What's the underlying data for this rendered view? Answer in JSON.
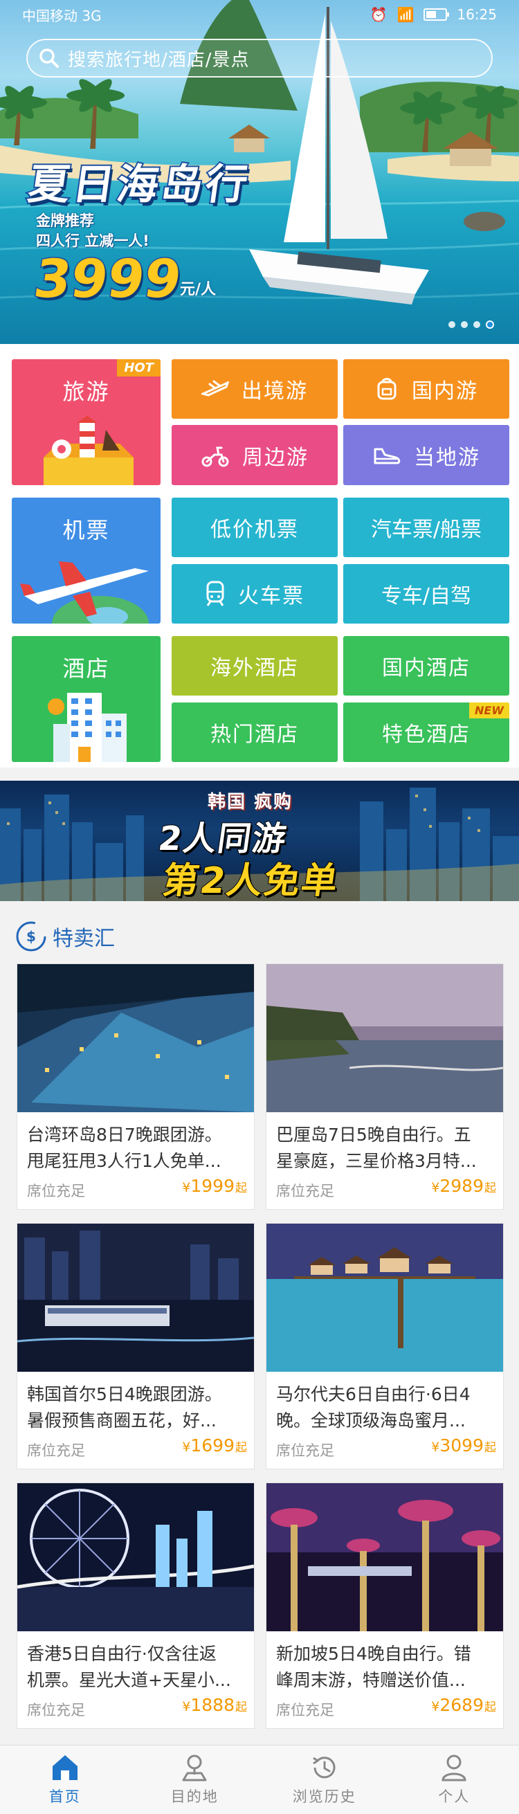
{
  "status_bar": {
    "carrier": "中国移动 3G",
    "network": "3G",
    "time": "16:25"
  },
  "search": {
    "placeholder": "搜索旅行地/酒店/景点"
  },
  "hero_banner": {
    "title": "夏日海岛行",
    "sub1": "金牌推荐",
    "sub2": "四人行 立减一人!",
    "price": "3999",
    "unit": "元/人",
    "dots": 4,
    "active_dot": 3
  },
  "categories": {
    "travel": {
      "label": "旅游",
      "tag": "HOT",
      "color": "#f0506e"
    },
    "outbound": {
      "label": "出境游",
      "color": "#f7911e",
      "icon": "airplane-icon"
    },
    "domestic": {
      "label": "国内游",
      "color": "#f7911e",
      "icon": "backpack-icon"
    },
    "nearby": {
      "label": "周边游",
      "color": "#ea4d86",
      "icon": "scooter-icon"
    },
    "local": {
      "label": "当地游",
      "color": "#7d79e0",
      "icon": "shoe-icon"
    },
    "flights": {
      "label": "机票",
      "color": "#3e8ee6"
    },
    "cheap_flights": {
      "label": "低价机票",
      "color": "#26b5cf"
    },
    "bus_ship": {
      "label": "汽车票/船票",
      "color": "#26b5cf"
    },
    "train": {
      "label": "火车票",
      "color": "#26b5cf",
      "icon": "train-icon"
    },
    "car": {
      "label": "专车/自驾",
      "color": "#26b5cf"
    },
    "hotel": {
      "label": "酒店",
      "color": "#34be5a"
    },
    "overseas_hotel": {
      "label": "海外酒店",
      "color": "#a8c42c"
    },
    "domestic_hotel": {
      "label": "国内酒店",
      "color": "#39c15a"
    },
    "hot_hotel": {
      "label": "热门酒店",
      "color": "#39c15a"
    },
    "special_hotel": {
      "label": "特色酒店",
      "color": "#39c15a",
      "tag": "NEW"
    }
  },
  "banner2": {
    "tag": "韩国 疯购",
    "line1": "2人同游",
    "line2": "第2人免单"
  },
  "special": {
    "title": "特卖汇",
    "items": [
      {
        "line1": "台湾环岛8日7晚跟团游。",
        "line2": "甩尾狂甩3人行1人免单...",
        "avail": "席位充足",
        "yen": "¥",
        "price": "1999",
        "qi": "起"
      },
      {
        "line1": "巴厘岛7日5晚自由行。五",
        "line2": "星豪庭，三星价格3月特...",
        "avail": "席位充足",
        "yen": "¥",
        "price": "2989",
        "qi": "起"
      },
      {
        "line1": "韩国首尔5日4晚跟团游。",
        "line2": "暑假预售商圈五花，好...",
        "avail": "席位充足",
        "yen": "¥",
        "price": "1699",
        "qi": "起"
      },
      {
        "line1": "马尔代夫6日自由行·6日4",
        "line2": "晚。全球顶级海岛蜜月...",
        "avail": "席位充足",
        "yen": "¥",
        "price": "3099",
        "qi": "起"
      },
      {
        "line1": "香港5日自由行·仅含往返",
        "line2": "机票。星光大道+天星小...",
        "avail": "席位充足",
        "yen": "¥",
        "price": "1888",
        "qi": "起"
      },
      {
        "line1": "新加坡5日4晚自由行。错",
        "line2": "峰周末游，特赠送价值...",
        "avail": "席位充足",
        "yen": "¥",
        "price": "2689",
        "qi": "起"
      }
    ]
  },
  "tabbar": {
    "home": "首页",
    "destination": "目的地",
    "history": "浏览历史",
    "profile": "个人",
    "active": "home"
  }
}
